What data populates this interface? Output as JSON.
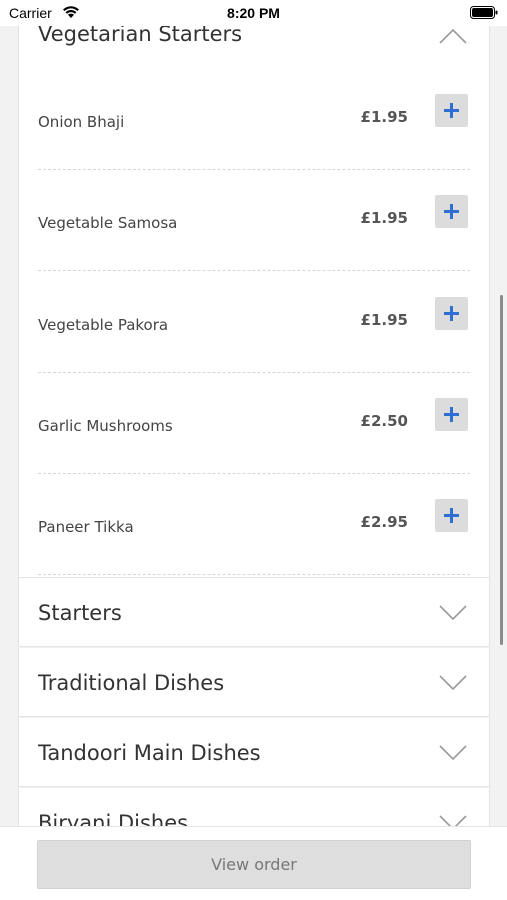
{
  "status_bar": {
    "carrier": "Carrier",
    "time": "8:20 PM"
  },
  "menu": {
    "expanded_section": {
      "title": "Vegetarian Starters",
      "items": [
        {
          "name": "Onion Bhaji",
          "price": "£1.95"
        },
        {
          "name": "Vegetable Samosa",
          "price": "£1.95"
        },
        {
          "name": "Vegetable Pakora",
          "price": "£1.95"
        },
        {
          "name": "Garlic Mushrooms",
          "price": "£2.50"
        },
        {
          "name": "Paneer Tikka",
          "price": "£2.95"
        }
      ]
    },
    "collapsed_sections": [
      {
        "title": "Starters"
      },
      {
        "title": "Traditional Dishes"
      },
      {
        "title": "Tandoori Main Dishes"
      },
      {
        "title": "Biryani Dishes"
      }
    ]
  },
  "footer": {
    "view_order_label": "View order"
  },
  "colors": {
    "accent_plus": "#2f6fd1",
    "button_bg": "#dcdcdc",
    "page_bg": "#f2f2f2"
  },
  "icons": {
    "add": "plus-icon",
    "expand": "chevron-down-icon",
    "collapse": "chevron-up-icon"
  }
}
